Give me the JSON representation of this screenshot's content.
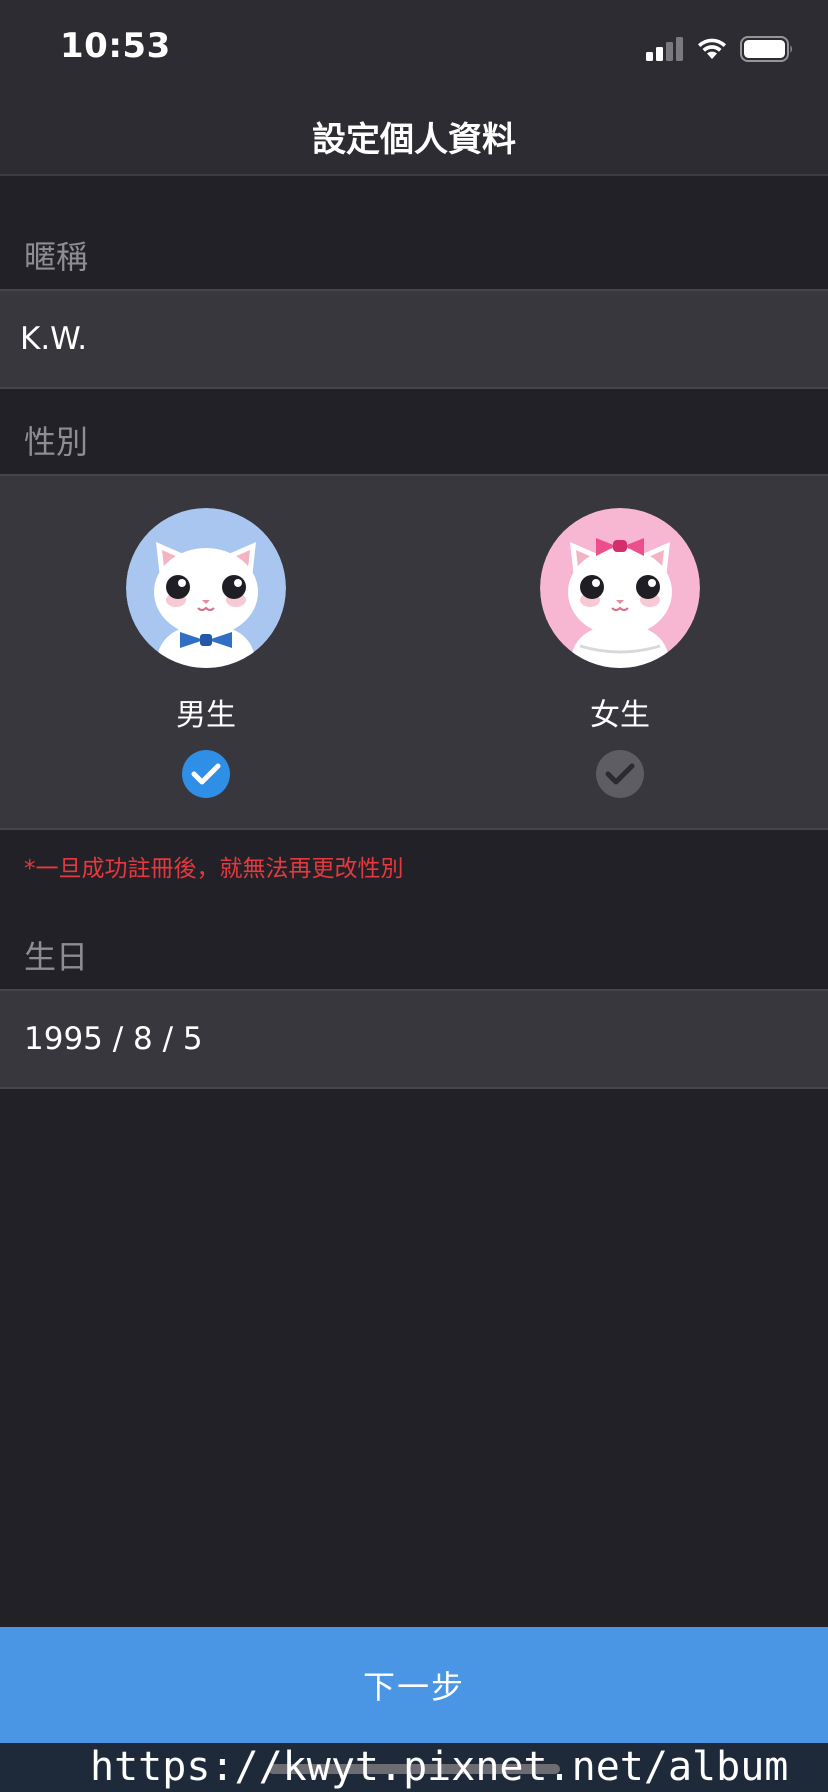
{
  "status_bar": {
    "time": "10:53",
    "icons": [
      "cellular-signal-icon",
      "wifi-icon",
      "battery-icon"
    ]
  },
  "nav": {
    "title": "設定個人資料"
  },
  "nickname": {
    "label": "暱稱",
    "value": "K.W."
  },
  "gender": {
    "label": "性別",
    "options": [
      {
        "label": "男生",
        "selected": true,
        "avatar_color": "#a9c6f0"
      },
      {
        "label": "女生",
        "selected": false,
        "avatar_color": "#f7b7d3"
      }
    ],
    "notice": "*一旦成功註冊後，就無法再更改性別"
  },
  "birthday": {
    "label": "生日",
    "value": "1995 / 8 / 5"
  },
  "next_button": {
    "label": "下一步"
  },
  "watermark": "https://kwyt.pixnet.net/album",
  "colors": {
    "background": "#222127",
    "field": "#38373d",
    "accent": "#4a95e4",
    "check_selected": "#2f8ee6",
    "check_unselected": "#5e5d63",
    "notice": "#e5383f"
  }
}
